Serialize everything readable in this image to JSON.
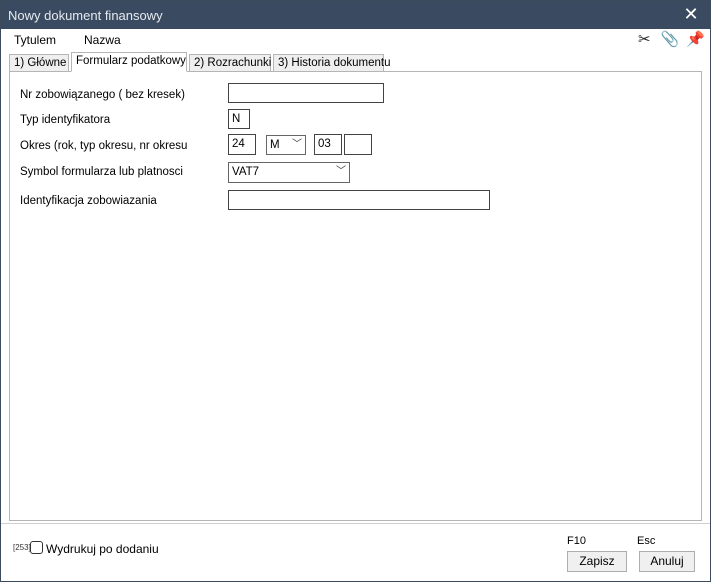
{
  "window": {
    "title": "Nowy dokument finansowy"
  },
  "menu": {
    "items": [
      "Tytulem",
      "Nazwa"
    ]
  },
  "toolbar": {
    "icons": [
      "scissors-icon",
      "paperclip-icon",
      "pin-icon"
    ],
    "glyphs": [
      "✂",
      "📎",
      "📌"
    ]
  },
  "tabs": [
    {
      "label": "1) Główne"
    },
    {
      "label": "Formularz podatkowy"
    },
    {
      "label": "2) Rozrachunki"
    },
    {
      "label": "3) Historia dokumentu"
    }
  ],
  "form": {
    "nr_label": "Nr  zobowiązanego ( bez kresek)",
    "nr_value": "",
    "typ_label": "Typ identyfikatora",
    "typ_value": "N",
    "okres_label": "Okres (rok, typ okresu, nr okresu",
    "okres_rok": "24",
    "okres_typ": "M",
    "okres_nr": "03",
    "okres_extra": "",
    "symbol_label": "Symbol formularza lub platnosci",
    "symbol_value": "VAT7",
    "ident_label": "Identyfikacja zobowiazania",
    "ident_value": ""
  },
  "footer": {
    "checkbox_code": "[253]",
    "checkbox_label": "Wydrukuj po dodaniu",
    "save_key": "F10",
    "cancel_key": "Esc",
    "save_label": "Zapisz",
    "cancel_label": "Anuluj"
  }
}
